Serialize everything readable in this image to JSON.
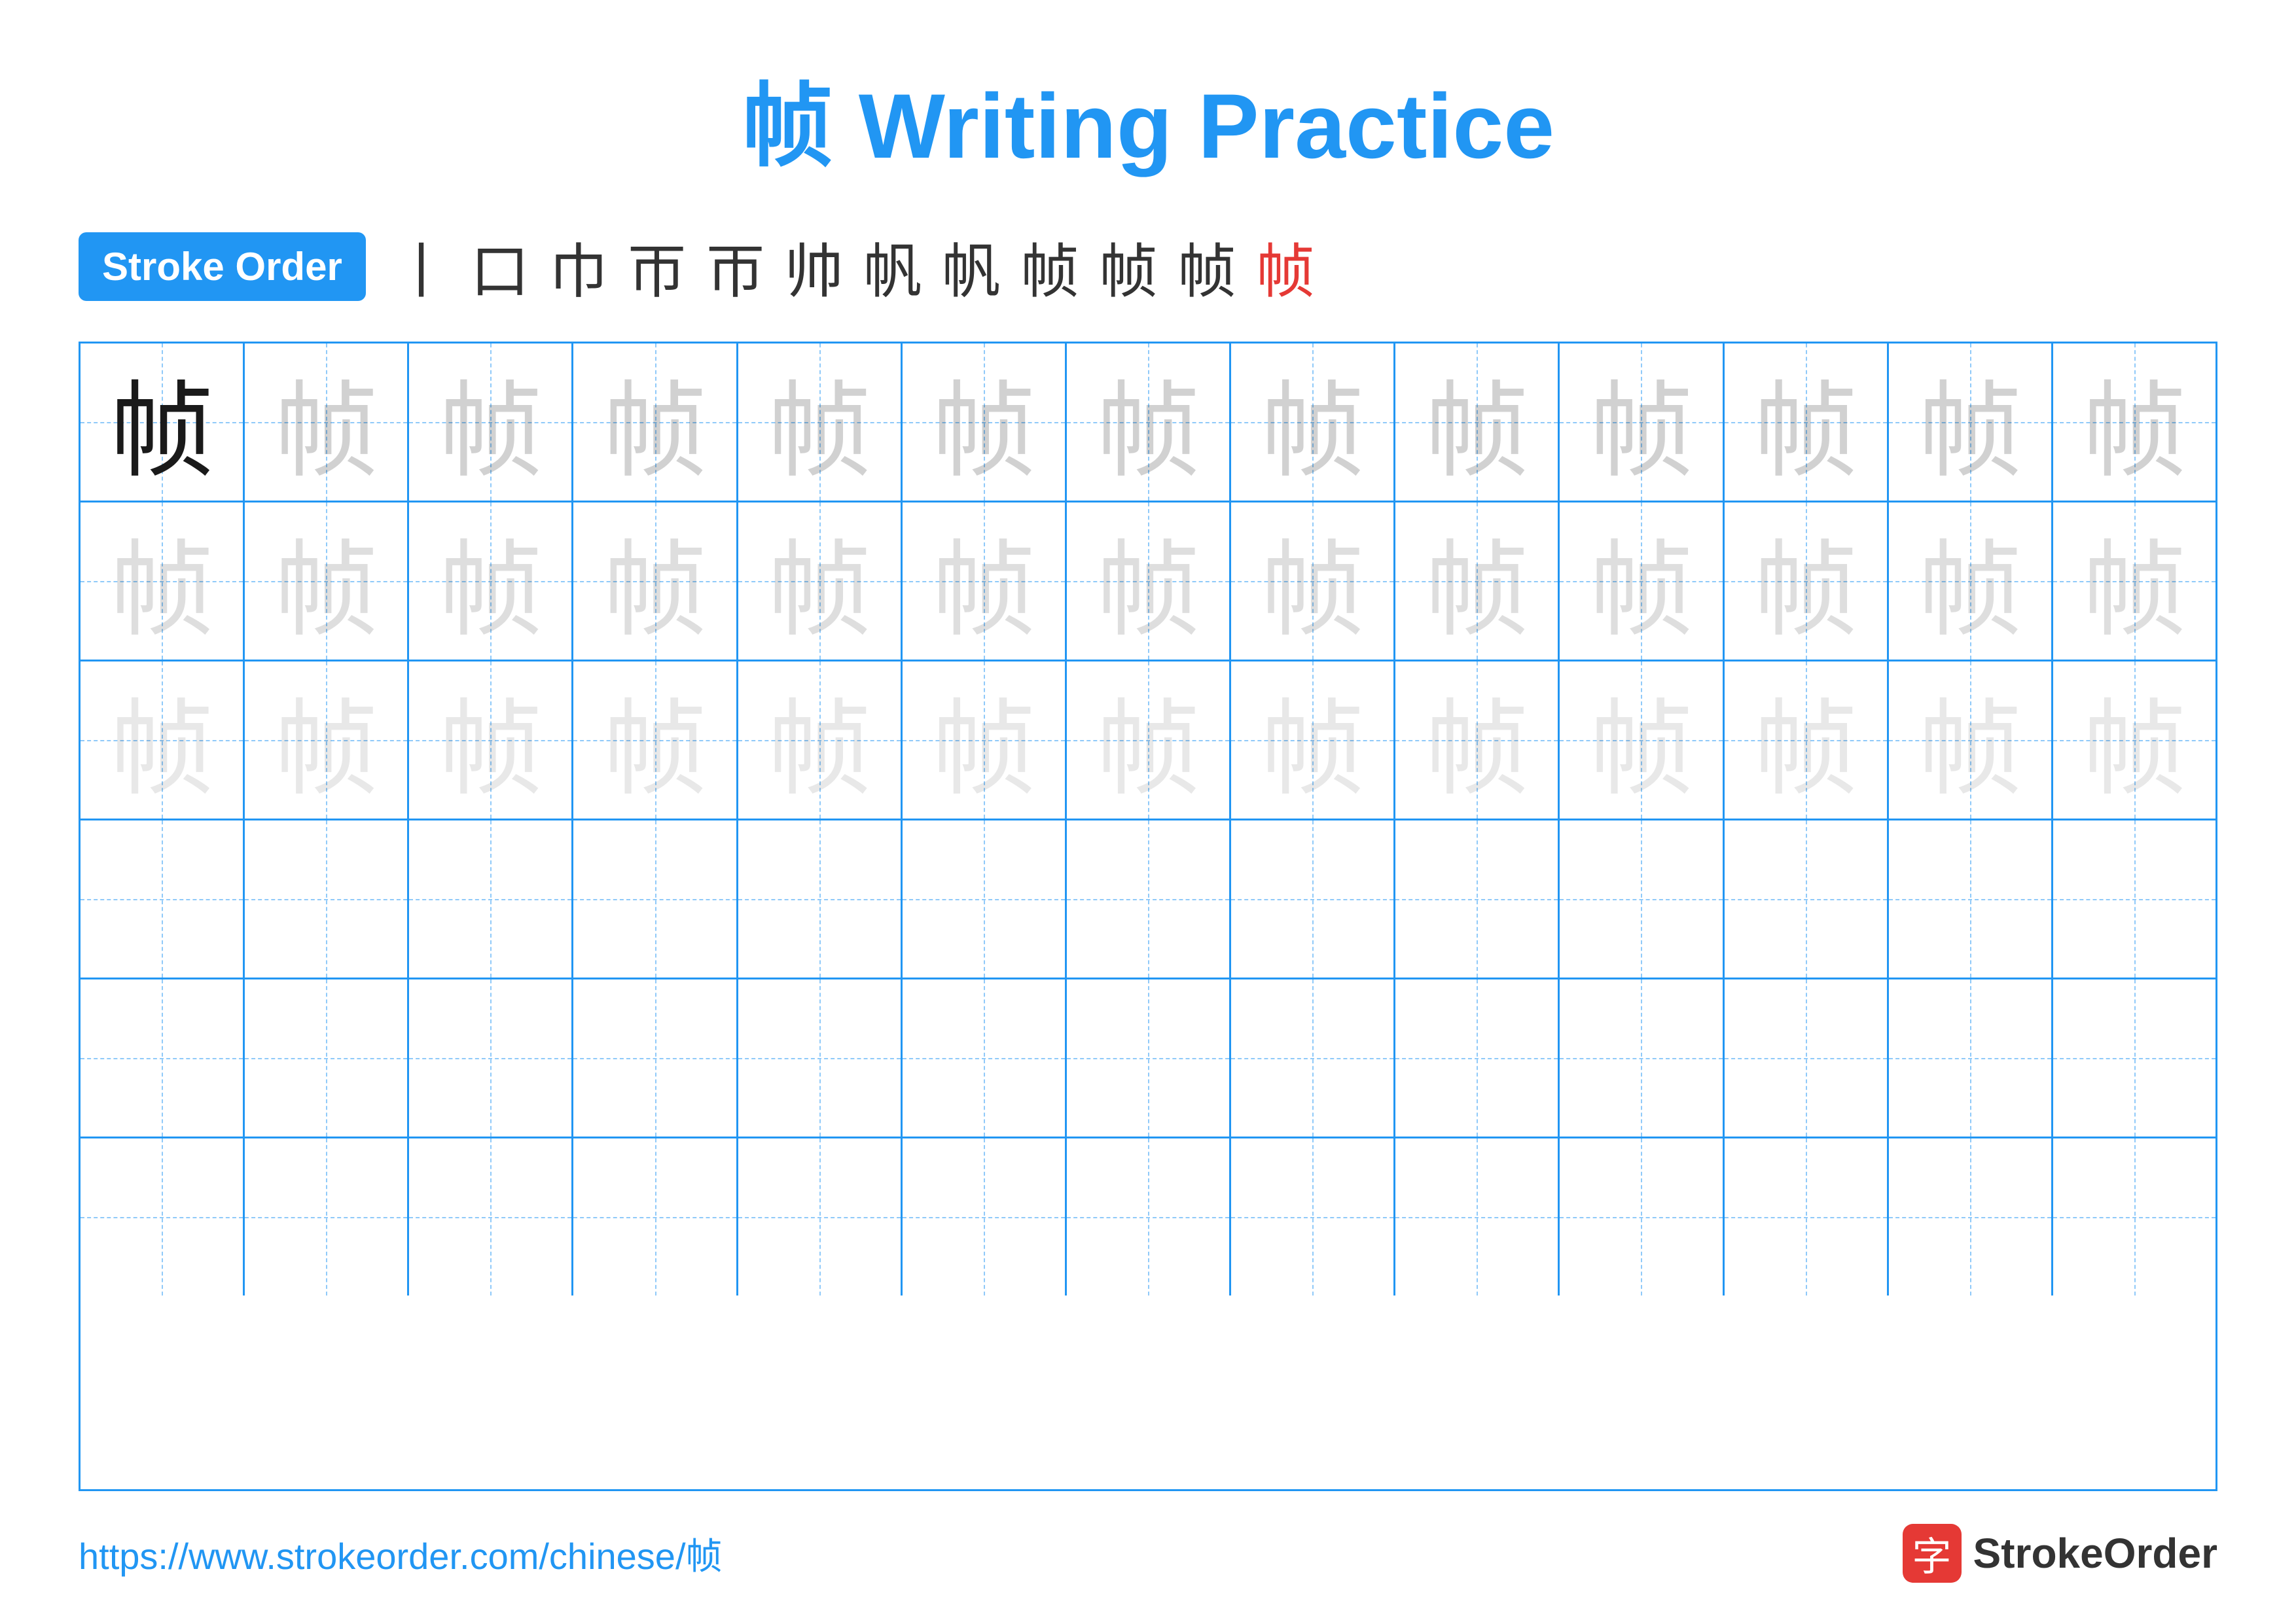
{
  "title": "帧 Writing Practice",
  "stroke_order_badge": "Stroke Order",
  "stroke_chars": [
    "丨",
    "口",
    "巾",
    "帀",
    "帀",
    "帅",
    "帆",
    "帆",
    "帧",
    "帧",
    "帧",
    "帧"
  ],
  "stroke_chars_red_index": 11,
  "character": "帧",
  "rows": [
    {
      "cells": [
        {
          "char": "帧",
          "style": "dark"
        },
        {
          "char": "帧",
          "style": "light1"
        },
        {
          "char": "帧",
          "style": "light1"
        },
        {
          "char": "帧",
          "style": "light1"
        },
        {
          "char": "帧",
          "style": "light1"
        },
        {
          "char": "帧",
          "style": "light1"
        },
        {
          "char": "帧",
          "style": "light1"
        },
        {
          "char": "帧",
          "style": "light1"
        },
        {
          "char": "帧",
          "style": "light1"
        },
        {
          "char": "帧",
          "style": "light1"
        },
        {
          "char": "帧",
          "style": "light1"
        },
        {
          "char": "帧",
          "style": "light1"
        },
        {
          "char": "帧",
          "style": "light1"
        }
      ]
    },
    {
      "cells": [
        {
          "char": "帧",
          "style": "light2"
        },
        {
          "char": "帧",
          "style": "light2"
        },
        {
          "char": "帧",
          "style": "light2"
        },
        {
          "char": "帧",
          "style": "light2"
        },
        {
          "char": "帧",
          "style": "light2"
        },
        {
          "char": "帧",
          "style": "light2"
        },
        {
          "char": "帧",
          "style": "light2"
        },
        {
          "char": "帧",
          "style": "light2"
        },
        {
          "char": "帧",
          "style": "light2"
        },
        {
          "char": "帧",
          "style": "light2"
        },
        {
          "char": "帧",
          "style": "light2"
        },
        {
          "char": "帧",
          "style": "light2"
        },
        {
          "char": "帧",
          "style": "light2"
        }
      ]
    },
    {
      "cells": [
        {
          "char": "帧",
          "style": "light3"
        },
        {
          "char": "帧",
          "style": "light3"
        },
        {
          "char": "帧",
          "style": "light3"
        },
        {
          "char": "帧",
          "style": "light3"
        },
        {
          "char": "帧",
          "style": "light3"
        },
        {
          "char": "帧",
          "style": "light3"
        },
        {
          "char": "帧",
          "style": "light3"
        },
        {
          "char": "帧",
          "style": "light3"
        },
        {
          "char": "帧",
          "style": "light3"
        },
        {
          "char": "帧",
          "style": "light3"
        },
        {
          "char": "帧",
          "style": "light3"
        },
        {
          "char": "帧",
          "style": "light3"
        },
        {
          "char": "帧",
          "style": "light3"
        }
      ]
    },
    {
      "cells": [
        {
          "char": "",
          "style": "empty"
        },
        {
          "char": "",
          "style": "empty"
        },
        {
          "char": "",
          "style": "empty"
        },
        {
          "char": "",
          "style": "empty"
        },
        {
          "char": "",
          "style": "empty"
        },
        {
          "char": "",
          "style": "empty"
        },
        {
          "char": "",
          "style": "empty"
        },
        {
          "char": "",
          "style": "empty"
        },
        {
          "char": "",
          "style": "empty"
        },
        {
          "char": "",
          "style": "empty"
        },
        {
          "char": "",
          "style": "empty"
        },
        {
          "char": "",
          "style": "empty"
        },
        {
          "char": "",
          "style": "empty"
        }
      ]
    },
    {
      "cells": [
        {
          "char": "",
          "style": "empty"
        },
        {
          "char": "",
          "style": "empty"
        },
        {
          "char": "",
          "style": "empty"
        },
        {
          "char": "",
          "style": "empty"
        },
        {
          "char": "",
          "style": "empty"
        },
        {
          "char": "",
          "style": "empty"
        },
        {
          "char": "",
          "style": "empty"
        },
        {
          "char": "",
          "style": "empty"
        },
        {
          "char": "",
          "style": "empty"
        },
        {
          "char": "",
          "style": "empty"
        },
        {
          "char": "",
          "style": "empty"
        },
        {
          "char": "",
          "style": "empty"
        },
        {
          "char": "",
          "style": "empty"
        }
      ]
    },
    {
      "cells": [
        {
          "char": "",
          "style": "empty"
        },
        {
          "char": "",
          "style": "empty"
        },
        {
          "char": "",
          "style": "empty"
        },
        {
          "char": "",
          "style": "empty"
        },
        {
          "char": "",
          "style": "empty"
        },
        {
          "char": "",
          "style": "empty"
        },
        {
          "char": "",
          "style": "empty"
        },
        {
          "char": "",
          "style": "empty"
        },
        {
          "char": "",
          "style": "empty"
        },
        {
          "char": "",
          "style": "empty"
        },
        {
          "char": "",
          "style": "empty"
        },
        {
          "char": "",
          "style": "empty"
        },
        {
          "char": "",
          "style": "empty"
        }
      ]
    }
  ],
  "footer": {
    "url": "https://www.strokeorder.com/chinese/帧",
    "logo_text": "StrokeOrder",
    "logo_icon": "字"
  }
}
